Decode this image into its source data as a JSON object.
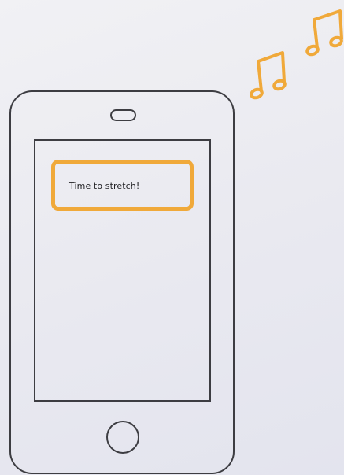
{
  "notification": {
    "message": "Time to stretch!"
  },
  "icons": {
    "music": "music-notes-icon",
    "speaker": "speaker-slot-icon",
    "home": "home-button-icon"
  },
  "colors": {
    "background": "#ececf1",
    "phone_outline": "#3d3d42",
    "accent": "#f0a93a",
    "text": "#1f1f22"
  }
}
